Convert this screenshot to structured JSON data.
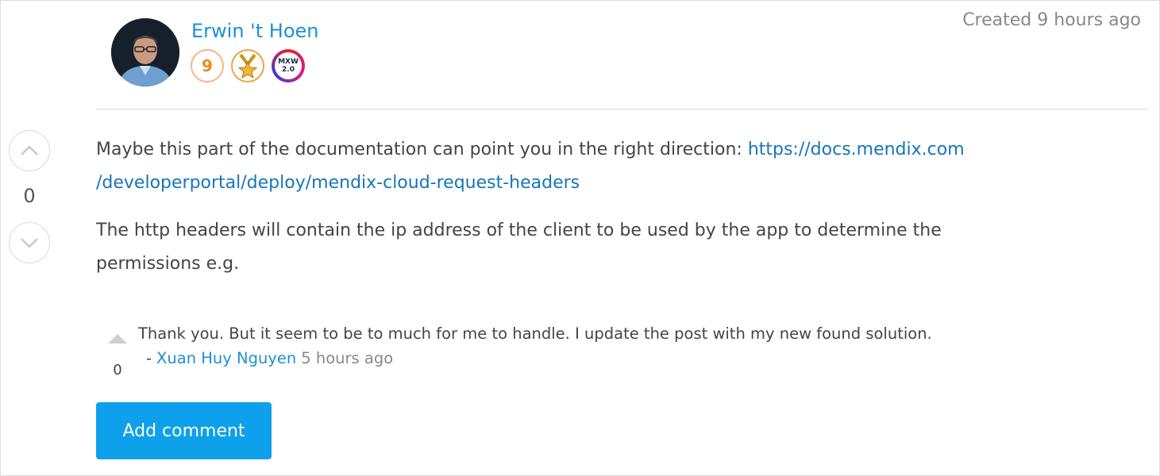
{
  "answer": {
    "author": {
      "name": "Erwin 't Hoen",
      "level": "9",
      "badges": [
        "level-badge",
        "medal-star-icon",
        "mxw-badge"
      ],
      "mxw_text_top": "MXW",
      "mxw_text_bottom": "2.0"
    },
    "created": "Created 9 hours ago",
    "votes": "0",
    "body": {
      "p1_text": "Maybe this part of the documentation can point you in the right direction: ",
      "p1_link_line1": "https://docs.mendix.com",
      "p1_link_line2": "/developerportal/deploy/mendix-cloud-request-headers",
      "p2_text": "The http headers will contain the ip address of the client to be used by the app to determine the permissions e.g."
    },
    "comments": [
      {
        "votes": "0",
        "text": "Thank you. But it seem to be to much for me to handle. I update the post with my new found solution.",
        "dash": "-",
        "author": "Xuan Huy Nguyen",
        "time": "5 hours ago"
      }
    ],
    "add_comment_label": "Add comment"
  },
  "colors": {
    "link": "#1676b8",
    "author": "#1f8fd6",
    "button": "#0ea0ea",
    "level_badge": "#f08a1c"
  }
}
